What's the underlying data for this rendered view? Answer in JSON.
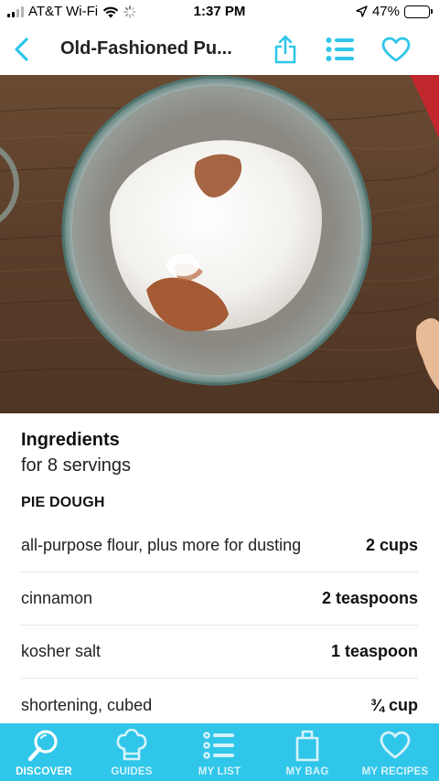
{
  "status_bar": {
    "carrier": "AT&T Wi-Fi",
    "time": "1:37 PM",
    "battery": "47%",
    "battery_level": 0.47
  },
  "nav": {
    "title": "Old-Fashioned Pu...",
    "icons": [
      "back-chevron-icon",
      "share-icon",
      "list-icon",
      "heart-icon"
    ]
  },
  "colors": {
    "accent": "#30c6ea",
    "tab_bar": "#30c6ea"
  },
  "ingredients": {
    "title": "Ingredients",
    "servings": "for 8 servings",
    "section": "PIE DOUGH",
    "items": [
      {
        "name": "all-purpose flour, plus more for dusting",
        "qty": "2 cups"
      },
      {
        "name": "cinnamon",
        "qty": "2 teaspoons"
      },
      {
        "name": "kosher salt",
        "qty": "1 teaspoon"
      },
      {
        "name": "shortening, cubed",
        "qty": "¾ cup"
      }
    ]
  },
  "tabs": [
    {
      "label": "DISCOVER",
      "icon": "search-icon",
      "active": true
    },
    {
      "label": "GUIDES",
      "icon": "chef-hat-icon",
      "active": false
    },
    {
      "label": "MY LIST",
      "icon": "list-icon",
      "active": false
    },
    {
      "label": "MY BAG",
      "icon": "bag-icon",
      "active": false
    },
    {
      "label": "MY RECIPES",
      "icon": "heart-icon",
      "active": false
    }
  ]
}
